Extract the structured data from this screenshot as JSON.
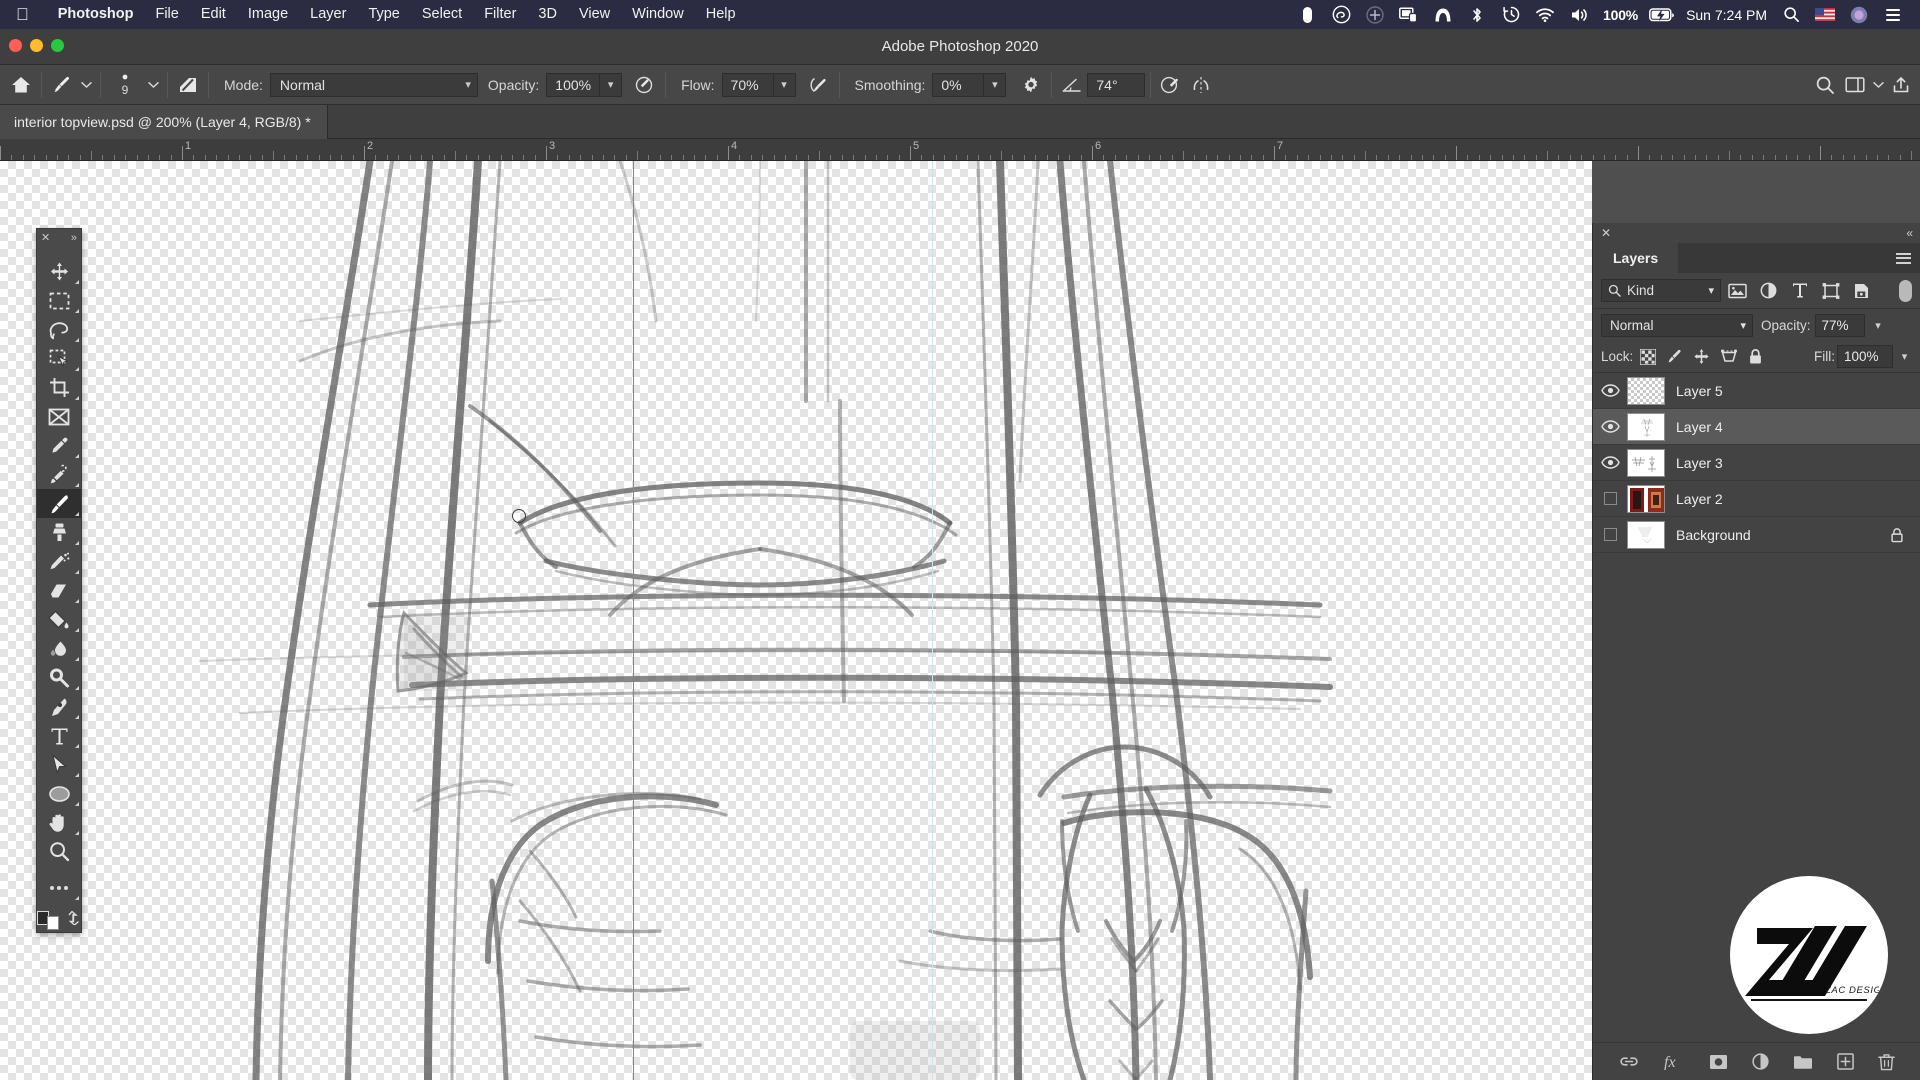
{
  "menubar": {
    "apple": "apple-logo",
    "items": [
      {
        "label": "Photoshop",
        "bold": true
      },
      {
        "label": "File",
        "bold": false
      },
      {
        "label": "Edit",
        "bold": false
      },
      {
        "label": "Image",
        "bold": false
      },
      {
        "label": "Layer",
        "bold": false
      },
      {
        "label": "Type",
        "bold": false
      },
      {
        "label": "Select",
        "bold": false
      },
      {
        "label": "Filter",
        "bold": false
      },
      {
        "label": "3D",
        "bold": false
      },
      {
        "label": "View",
        "bold": false
      },
      {
        "label": "Window",
        "bold": false
      },
      {
        "label": "Help",
        "bold": false
      }
    ],
    "status_icons": [
      "record-indicator-icon",
      "creative-cloud-icon",
      "plus-circle-icon",
      "display-sharing-icon",
      "malwarebytes-icon",
      "bluetooth-icon",
      "time-machine-icon",
      "wifi-icon",
      "volume-icon"
    ],
    "battery_percent": "100%",
    "battery_icon": "battery-charging-icon",
    "clock": "Sun 7:24 PM",
    "spotlight_icon": "search-icon",
    "flag_icon": "us-flag-icon",
    "siri_icon": "siri-icon",
    "control_center_icon": "control-center-icon"
  },
  "titlebar": {
    "app_title": "Adobe Photoshop 2020"
  },
  "options_bar": {
    "home_icon": "home-icon",
    "brush_preset_icon": "brush-preset-icon",
    "brush_size": "9",
    "brush_panel_icon": "brush-settings-panel-icon",
    "mode_label": "Mode:",
    "mode_value": "Normal",
    "opacity_label": "Opacity:",
    "opacity_value": "100%",
    "opacity_pressure_icon": "pressure-opacity-icon",
    "flow_label": "Flow:",
    "flow_value": "70%",
    "airbrush_icon": "airbrush-icon",
    "smoothing_label": "Smoothing:",
    "smoothing_value": "0%",
    "smoothing_options_icon": "gear-icon",
    "angle_icon": "brush-angle-icon",
    "angle_value": "74°",
    "pressure_size_icon": "pressure-size-icon",
    "symmetry_icon": "symmetry-icon",
    "search_icon": "search-icon",
    "workspace_icon": "workspace-icon",
    "share_icon": "share-icon"
  },
  "document": {
    "tab_title": "interior topview.psd @ 200% (Layer 4, RGB/8) *"
  },
  "ruler": {
    "labels": [
      "1",
      "2",
      "3",
      "4",
      "5",
      "6",
      "7"
    ]
  },
  "tools": [
    {
      "name": "move-tool",
      "icon": "move-icon",
      "active": false,
      "has_flyout": true
    },
    {
      "name": "marquee-tool",
      "icon": "rectangular-marquee-icon",
      "active": false,
      "has_flyout": true
    },
    {
      "name": "lasso-tool",
      "icon": "lasso-icon",
      "active": false,
      "has_flyout": true
    },
    {
      "name": "object-selection-tool",
      "icon": "object-selection-icon",
      "active": false,
      "has_flyout": true
    },
    {
      "name": "crop-tool",
      "icon": "crop-icon",
      "active": false,
      "has_flyout": true
    },
    {
      "name": "frame-tool",
      "icon": "frame-icon",
      "active": false,
      "has_flyout": false
    },
    {
      "name": "eyedropper-tool",
      "icon": "eyedropper-icon",
      "active": false,
      "has_flyout": true
    },
    {
      "name": "spot-healing-tool",
      "icon": "spot-healing-brush-icon",
      "active": false,
      "has_flyout": true
    },
    {
      "name": "brush-tool",
      "icon": "brush-icon",
      "active": true,
      "has_flyout": true
    },
    {
      "name": "clone-stamp-tool",
      "icon": "clone-stamp-icon",
      "active": false,
      "has_flyout": true
    },
    {
      "name": "history-brush-tool",
      "icon": "history-brush-icon",
      "active": false,
      "has_flyout": true
    },
    {
      "name": "eraser-tool",
      "icon": "eraser-icon",
      "active": false,
      "has_flyout": true
    },
    {
      "name": "gradient-tool",
      "icon": "paint-bucket-icon",
      "active": false,
      "has_flyout": true
    },
    {
      "name": "blur-tool",
      "icon": "blur-icon",
      "active": false,
      "has_flyout": true
    },
    {
      "name": "dodge-tool",
      "icon": "dodge-icon",
      "active": false,
      "has_flyout": true
    },
    {
      "name": "pen-tool",
      "icon": "pen-icon",
      "active": false,
      "has_flyout": true
    },
    {
      "name": "type-tool",
      "icon": "type-icon",
      "active": false,
      "has_flyout": true
    },
    {
      "name": "path-selection-tool",
      "icon": "path-selection-arrow-icon",
      "active": false,
      "has_flyout": true
    },
    {
      "name": "ellipse-tool",
      "icon": "ellipse-icon",
      "active": false,
      "has_flyout": true
    },
    {
      "name": "hand-tool",
      "icon": "hand-icon",
      "active": false,
      "has_flyout": true
    },
    {
      "name": "zoom-tool",
      "icon": "zoom-icon",
      "active": false,
      "has_flyout": false
    },
    {
      "name": "edit-toolbar",
      "icon": "ellipsis-icon",
      "active": false,
      "has_flyout": true
    }
  ],
  "tools_panel": {
    "close_icon": "close-icon",
    "expand_icon": "expand-collapse-icon",
    "foreground_swatch": "#2a2a2a",
    "background_swatch": "#ffffff",
    "swap_icon": "swap-colors-icon"
  },
  "layers_panel": {
    "close_icon": "close-icon",
    "collapse_icon": "collapse-panel-icon",
    "tab_label": "Layers",
    "menu_icon": "panel-menu-icon",
    "filter": {
      "search_icon": "search-icon",
      "kind_label": "Kind",
      "chevron": "chevron-down-icon",
      "type_filters": [
        "pixel-layer-filter-icon",
        "adjustment-layer-filter-icon",
        "type-layer-filter-icon",
        "shape-layer-filter-icon",
        "smart-object-filter-icon"
      ],
      "toggle_icon": "filter-toggle-switch"
    },
    "blend_mode": "Normal",
    "opacity_label": "Opacity:",
    "opacity_value": "77%",
    "lock_label": "Lock:",
    "lock_icons": [
      "lock-transparent-pixels-icon",
      "lock-image-pixels-icon",
      "lock-position-icon",
      "lock-artboard-nesting-icon",
      "lock-all-icon"
    ],
    "fill_label": "Fill:",
    "fill_value": "100%",
    "layers": [
      {
        "name": "Layer 5",
        "visible": true,
        "selected": false,
        "locked": false,
        "thumb": "checker"
      },
      {
        "name": "Layer 4",
        "visible": true,
        "selected": true,
        "locked": false,
        "thumb": "sketch-light"
      },
      {
        "name": "Layer 3",
        "visible": true,
        "selected": false,
        "locked": false,
        "thumb": "sketch-lines"
      },
      {
        "name": "Layer 2",
        "visible": false,
        "selected": false,
        "locked": false,
        "thumb": "photo-red"
      },
      {
        "name": "Background",
        "visible": false,
        "selected": false,
        "locked": true,
        "thumb": "sketch-faint"
      }
    ],
    "bottom_icons": [
      "link-layers-icon",
      "layer-styles-fx-icon",
      "add-layer-mask-icon",
      "new-adjustment-layer-icon",
      "new-group-icon",
      "new-layer-icon",
      "delete-layer-icon"
    ]
  },
  "watermark": {
    "text": "ZAC DESIGN",
    "icon": "zac-design-logo"
  },
  "colors": {
    "menubar_bg": "#2b2b41",
    "panel_bg": "#434343",
    "options_bg": "#474747",
    "canvas_bg": "#4f4f4f",
    "selected_layer": "#5a5a5a",
    "guide_red": "#f05a5a",
    "accent_text": "#eeeeee"
  }
}
